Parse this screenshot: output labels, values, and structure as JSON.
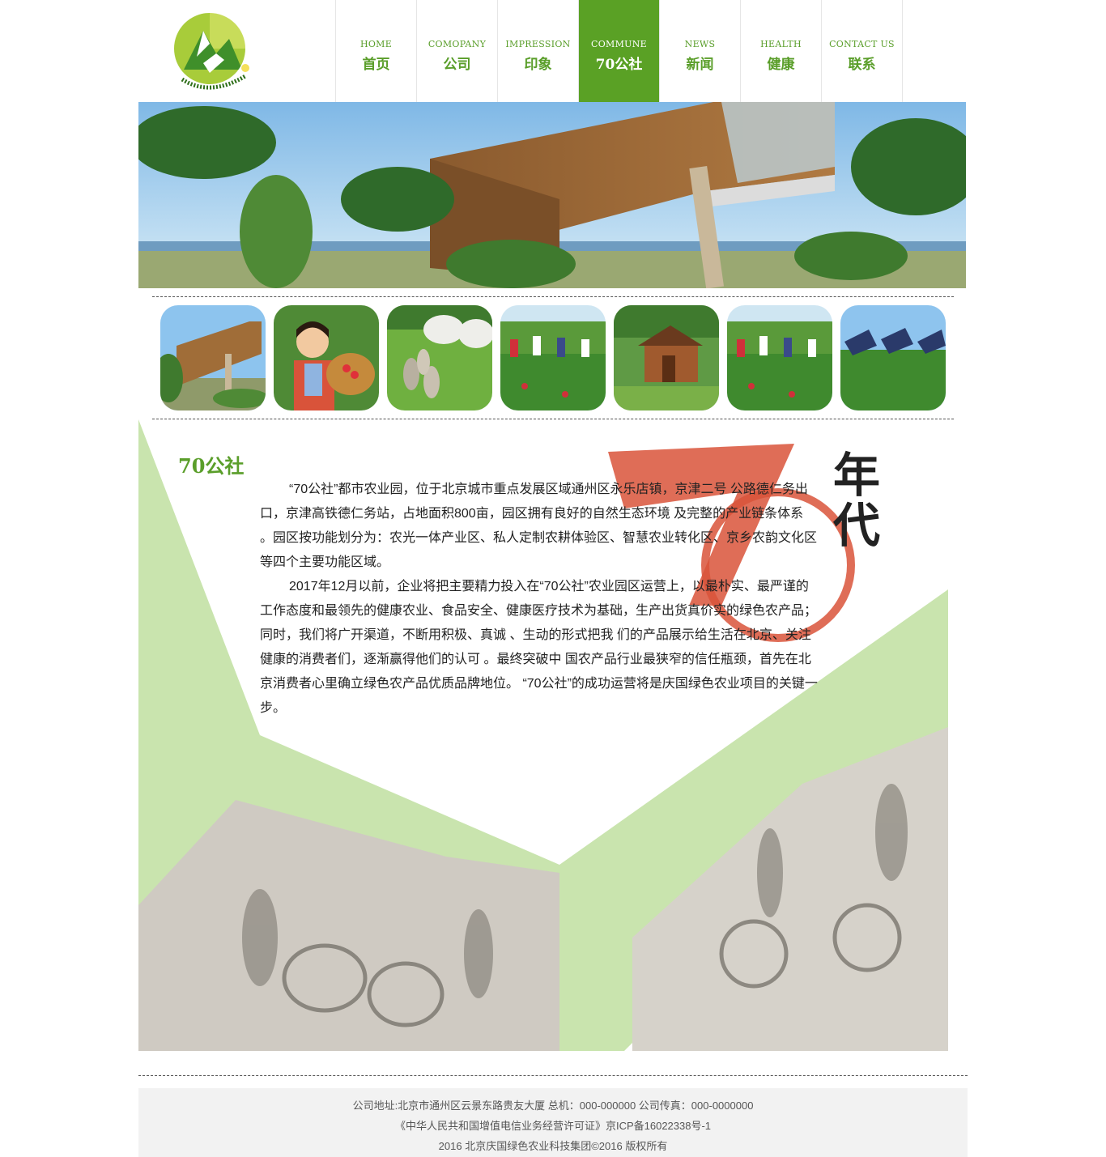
{
  "header": {
    "logo_icon": "company-logo",
    "nav": [
      {
        "en": "HOME",
        "cn": "首页"
      },
      {
        "en": "COMOPANY",
        "cn": "公司"
      },
      {
        "en": "IMPRESSION",
        "cn": "印象"
      },
      {
        "en": "COMMUNE",
        "cn": "70公社"
      },
      {
        "en": "NEWS",
        "cn": "新闻"
      },
      {
        "en": "HEALTH",
        "cn": "健康"
      },
      {
        "en": "CONTACT US",
        "cn": "联系"
      }
    ],
    "active_index": 3
  },
  "colors": {
    "brand_green": "#5aa125",
    "light_green": "#c9e4ae",
    "accent_red": "#d9533a"
  },
  "thumbnails": [
    "building-photo",
    "child-with-basket-photo",
    "goats-and-geese-photo",
    "farm-workers-photo",
    "wooden-cabin-photo",
    "farm-workers-photo",
    "solar-panels-photo"
  ],
  "main": {
    "title": "70公社",
    "decor_text": "年代",
    "paragraphs": [
      "“70公社”都市农业园，位于北京城市重点发展区域通州区永乐店镇，京津二号 公路德仁务出口，京津高铁德仁务站，占地面积800亩，园区拥有良好的自然生态环境 及完整的产业链条体系 。园区按功能划分为：农光一体产业区、私人定制农耕体验区、智慧农业转化区、京乡农韵文化区等四个主要功能区域。",
      "2017年12月以前，企业将把主要精力投入在“70公社”农业园区运营上，以最朴实、最严谨的工作态度和最领先的健康农业、食品安全、健康医疗技术为基础，生产出货真价实的绿色农产品；同时，我们将广开渠道，不断用积极、真诚 、生动的形式把我 们的产品展示给生活在北京、关注健康的消费者们，逐渐赢得他们的认可 。最终突破中 国农产品行业最狭窄的信任瓶颈，首先在北京消费者心里确立绿色农产品优质品牌地位。 “70公社”的成功运营将是庆国绿色农业项目的关键一步。"
    ]
  },
  "footer": {
    "line1": "公司地址:北京市通州区云景东路贵友大厦 总机：000-000000 公司传真：000-0000000",
    "line2": "《中华人民共和国增值电信业务经营许可证》京ICP备16022338号-1",
    "line3": "2016 北京庆国绿色农业科技集团©2016 版权所有"
  }
}
